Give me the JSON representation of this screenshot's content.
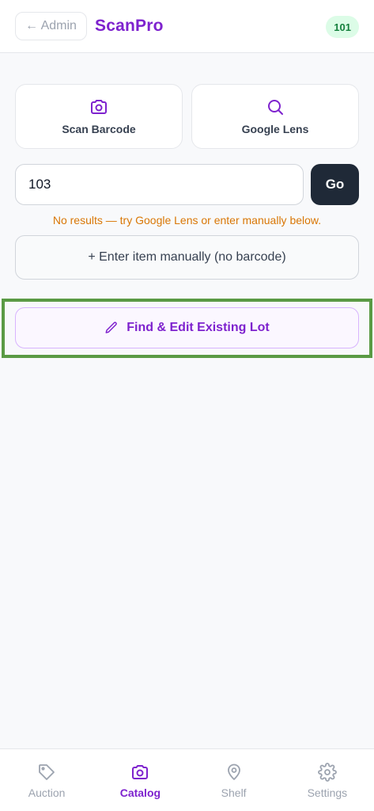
{
  "header": {
    "back_label": "← Admin",
    "brand": "ScanPro",
    "count_badge": "101"
  },
  "actions": {
    "scan_label": "Scan Barcode",
    "scan_icon": "camera-icon",
    "lens_label": "Google Lens",
    "lens_icon": "search-icon"
  },
  "search": {
    "value": "103",
    "go_label": "Go",
    "status": "No results — try Google Lens or enter manually below."
  },
  "manual": {
    "label": "+ Enter item manually (no barcode)"
  },
  "find": {
    "label": "Find & Edit Existing Lot",
    "icon": "pencil-icon"
  },
  "nav": {
    "items": [
      {
        "label": "Auction",
        "icon": "tag-icon",
        "active": false
      },
      {
        "label": "Catalog",
        "icon": "camera-icon",
        "active": true
      },
      {
        "label": "Shelf",
        "icon": "map-pin-icon",
        "active": false
      },
      {
        "label": "Settings",
        "icon": "gear-icon",
        "active": false
      }
    ]
  },
  "colors": {
    "brand": "#7e22ce",
    "status_warning": "#d97706",
    "highlight": "#5a9a44",
    "badge_bg": "#dcfce7",
    "badge_text": "#15803d"
  }
}
